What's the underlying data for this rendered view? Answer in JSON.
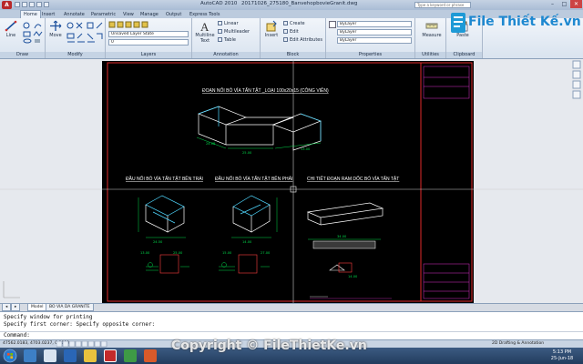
{
  "window": {
    "app_button": "A",
    "app_name": "AutoCAD 2010",
    "document_title": "20171026_275180_Banvehopbovie­Granit.dwg",
    "search_placeholder": "Type a keyword or phrase",
    "controls": {
      "minimize": "–",
      "maximize": "□",
      "close": "✕"
    }
  },
  "ribbon_tabs": [
    {
      "label": "Home",
      "active": true
    },
    {
      "label": "Insert"
    },
    {
      "label": "Annotate"
    },
    {
      "label": "Parametric"
    },
    {
      "label": "View"
    },
    {
      "label": "Manage"
    },
    {
      "label": "Output"
    },
    {
      "label": "Express Tools"
    }
  ],
  "panels": {
    "draw": {
      "title": "Draw",
      "line": "Line"
    },
    "modify": {
      "title": "Modify",
      "move": "Move"
    },
    "layers": {
      "title": "Layers",
      "layer_state": "Unsaved Layer State",
      "current_layer": "0"
    },
    "annotation": {
      "title": "Annotation",
      "text": "Multiline Text",
      "linear": "Linear",
      "multileader": "Multileader",
      "table": "Table"
    },
    "block": {
      "title": "Block",
      "insert": "Insert",
      "create": "Create",
      "edit": "Edit",
      "edit_attributes": "Edit Attributes"
    },
    "properties": {
      "title": "Properties",
      "color": "ByLayer",
      "linetype": "ByLayer",
      "lineweight": "ByLayer"
    },
    "utilities": {
      "title": "Utilities",
      "measure": "Measure"
    },
    "clipboard": {
      "title": "Clipboard",
      "paste": "Paste"
    }
  },
  "drawing": {
    "title_top": "ĐOẠN NỐI BÓ VỈA TẤN TẬT _LOẠI 100x20x15 (CÔNG VIÊN)",
    "title_left": "ĐẦU NỐI BÓ VỈA TẤN TẬT BÊN TRÁI",
    "title_mid": "ĐẦU NỐI BÓ VỈA TẤN TẬT BÊN PHẢI",
    "title_right": "CHI TIẾT ĐOẠN RAM DỐC BÓ VỈA TẤN TẬT",
    "dim_labels": [
      "24.08",
      "25.00",
      "13.00",
      "24.50",
      "13.00",
      "25.00",
      "14.00",
      "15.00",
      "27.00",
      "34.00",
      "14.00"
    ]
  },
  "layout_tabs": [
    "Model",
    "BO VIA DA GRANITE"
  ],
  "command": {
    "history": [
      "Specify window for printing",
      "Specify first corner: Specify opposite corner:"
    ],
    "prompt": "Command:"
  },
  "status": {
    "coordinates": "47562.0183, 4703.0237, 0.0000",
    "workspace": "2D Drafting & Annotation"
  },
  "taskbar": {
    "time": "5:13 PM",
    "date": "25-Jun-18"
  },
  "watermark": {
    "brand": "File Thiết Kế.vn",
    "copyright": "Copyright © FileThietKe.vn"
  },
  "colors": {
    "model_bg": "#000000",
    "dim_green": "#00d84a",
    "cyan": "#4fd8ff",
    "frame_red": "#e02a2a"
  }
}
